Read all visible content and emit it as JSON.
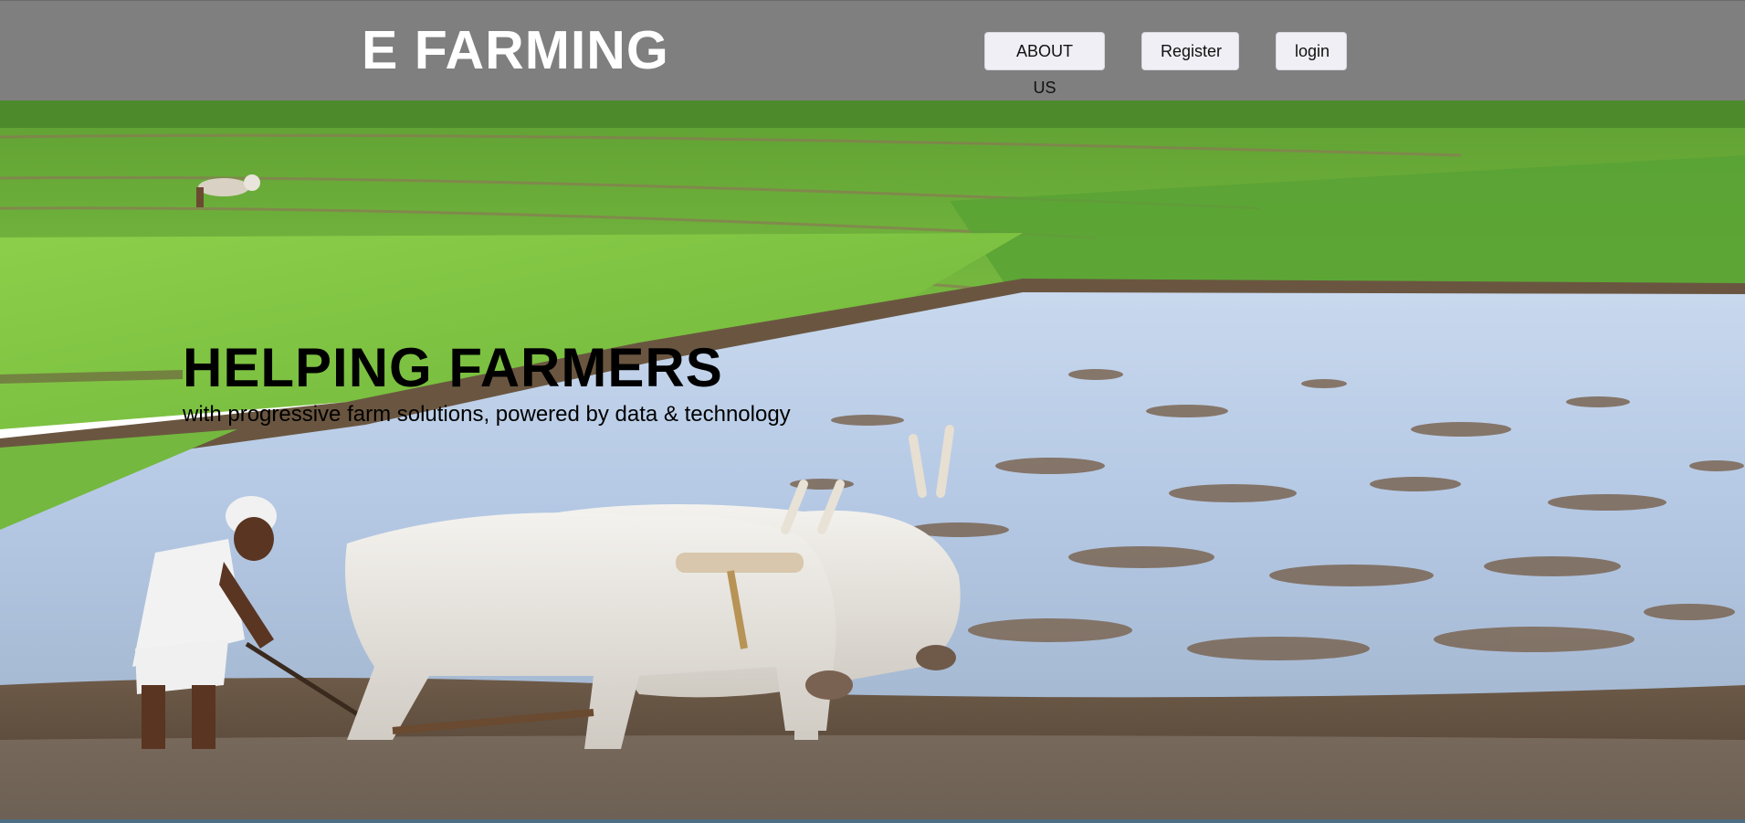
{
  "header": {
    "brand": "E FARMING",
    "nav": {
      "about_label": "ABOUT US",
      "register_label": "Register",
      "login_label": "login"
    }
  },
  "hero": {
    "headline": "HELPING FARMERS",
    "subheadline": "with progressive farm solutions, powered by data & technology",
    "image_subject": "farmer ploughing flooded rice paddy with two white oxen"
  },
  "colors": {
    "header_bg": "#7f7f7f",
    "brand_text": "#ffffff",
    "button_bg": "#efeff5",
    "headline_text": "#000000"
  }
}
